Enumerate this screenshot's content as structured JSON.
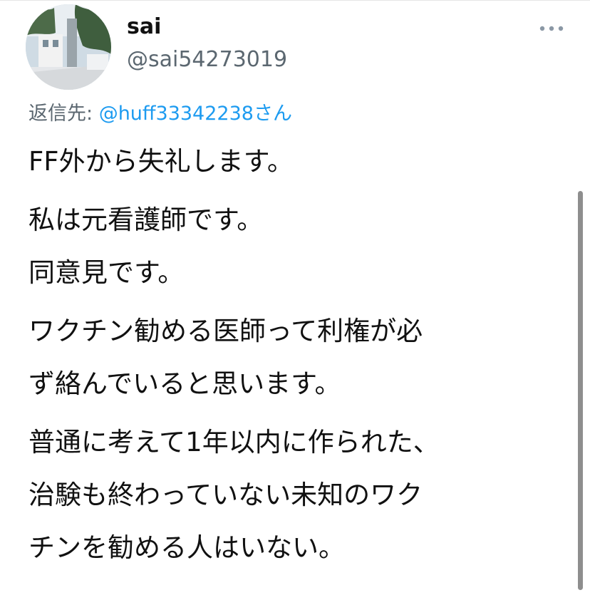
{
  "tweet": {
    "display_name": "sai",
    "handle": "@sai54273019",
    "more_icon": "more-horizontal-icon",
    "reply_prefix": "返信先: ",
    "reply_mention": "@huff33342238さん",
    "paragraphs": [
      {
        "lines": [
          "FF外から失礼します。"
        ]
      },
      {
        "lines": [
          "私は元看護師です。",
          "同意見です。"
        ]
      },
      {
        "lines": [
          "ワクチン勧める医師って利権が必",
          "ず絡んでいると思います。"
        ]
      },
      {
        "lines": [
          "普通に考えて1年以内に作られた、",
          "治験も終わっていない未知のワク",
          "チンを勧める人はいない。"
        ]
      }
    ]
  },
  "colors": {
    "link": "#1d9bf0",
    "secondary_text": "#5b6770",
    "primary_text": "#111111",
    "scrollbar": "#8e8e8e"
  }
}
